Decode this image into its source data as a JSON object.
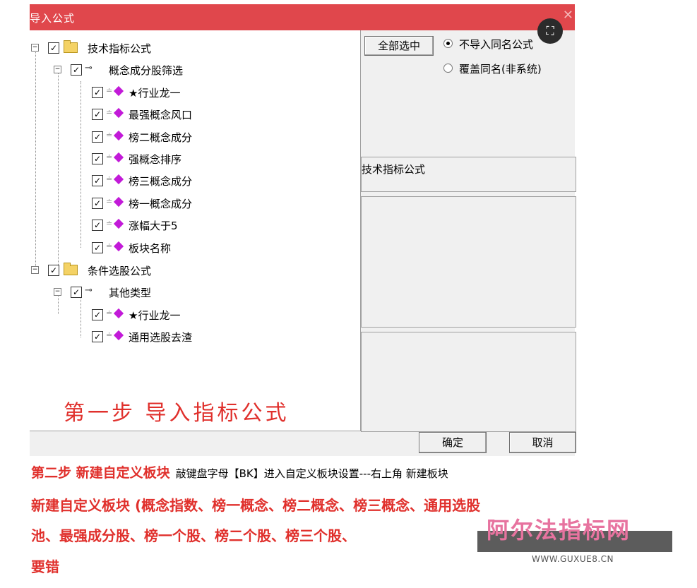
{
  "dialog": {
    "title": "导入公式",
    "close": "✕",
    "overlay_icon": "⛶",
    "tree": {
      "group1": "技术指标公式",
      "subgroup1": "概念成分股筛选",
      "items1": [
        "★行业龙一",
        "最强概念风口",
        "榜二概念成分",
        "强概念排序",
        "榜三概念成分",
        "榜一概念成分",
        "涨幅大于5",
        "板块名称"
      ],
      "group2": "条件选股公式",
      "subgroup2": "其他类型",
      "items2": [
        "★行业龙一",
        "通用选股去渣"
      ]
    },
    "select_all": "全部选中",
    "radio_no_import": "不导入同名公式",
    "radio_overwrite": "覆盖同名(非系统)",
    "panel_label": "技术指标公式",
    "ok": "确定",
    "cancel": "取消",
    "step1": "第一步   导入指标公式"
  },
  "instructions": {
    "step2_title": "第二步  新建自定义板块",
    "step2_desc": "敲键盘字母【BK】进入自定义板块设置---右上角 新建板块",
    "line1": "新建自定义板块 (概念指数、榜一概念、榜二概念、榜三概念、通用选股",
    "line2": "池、最强成分股、榜一个股、榜二个股、榜三个股、",
    "line3": "要错"
  },
  "watermark": {
    "text": "阿尔法指标网",
    "url": "WWW.GUXUE8.CN"
  }
}
